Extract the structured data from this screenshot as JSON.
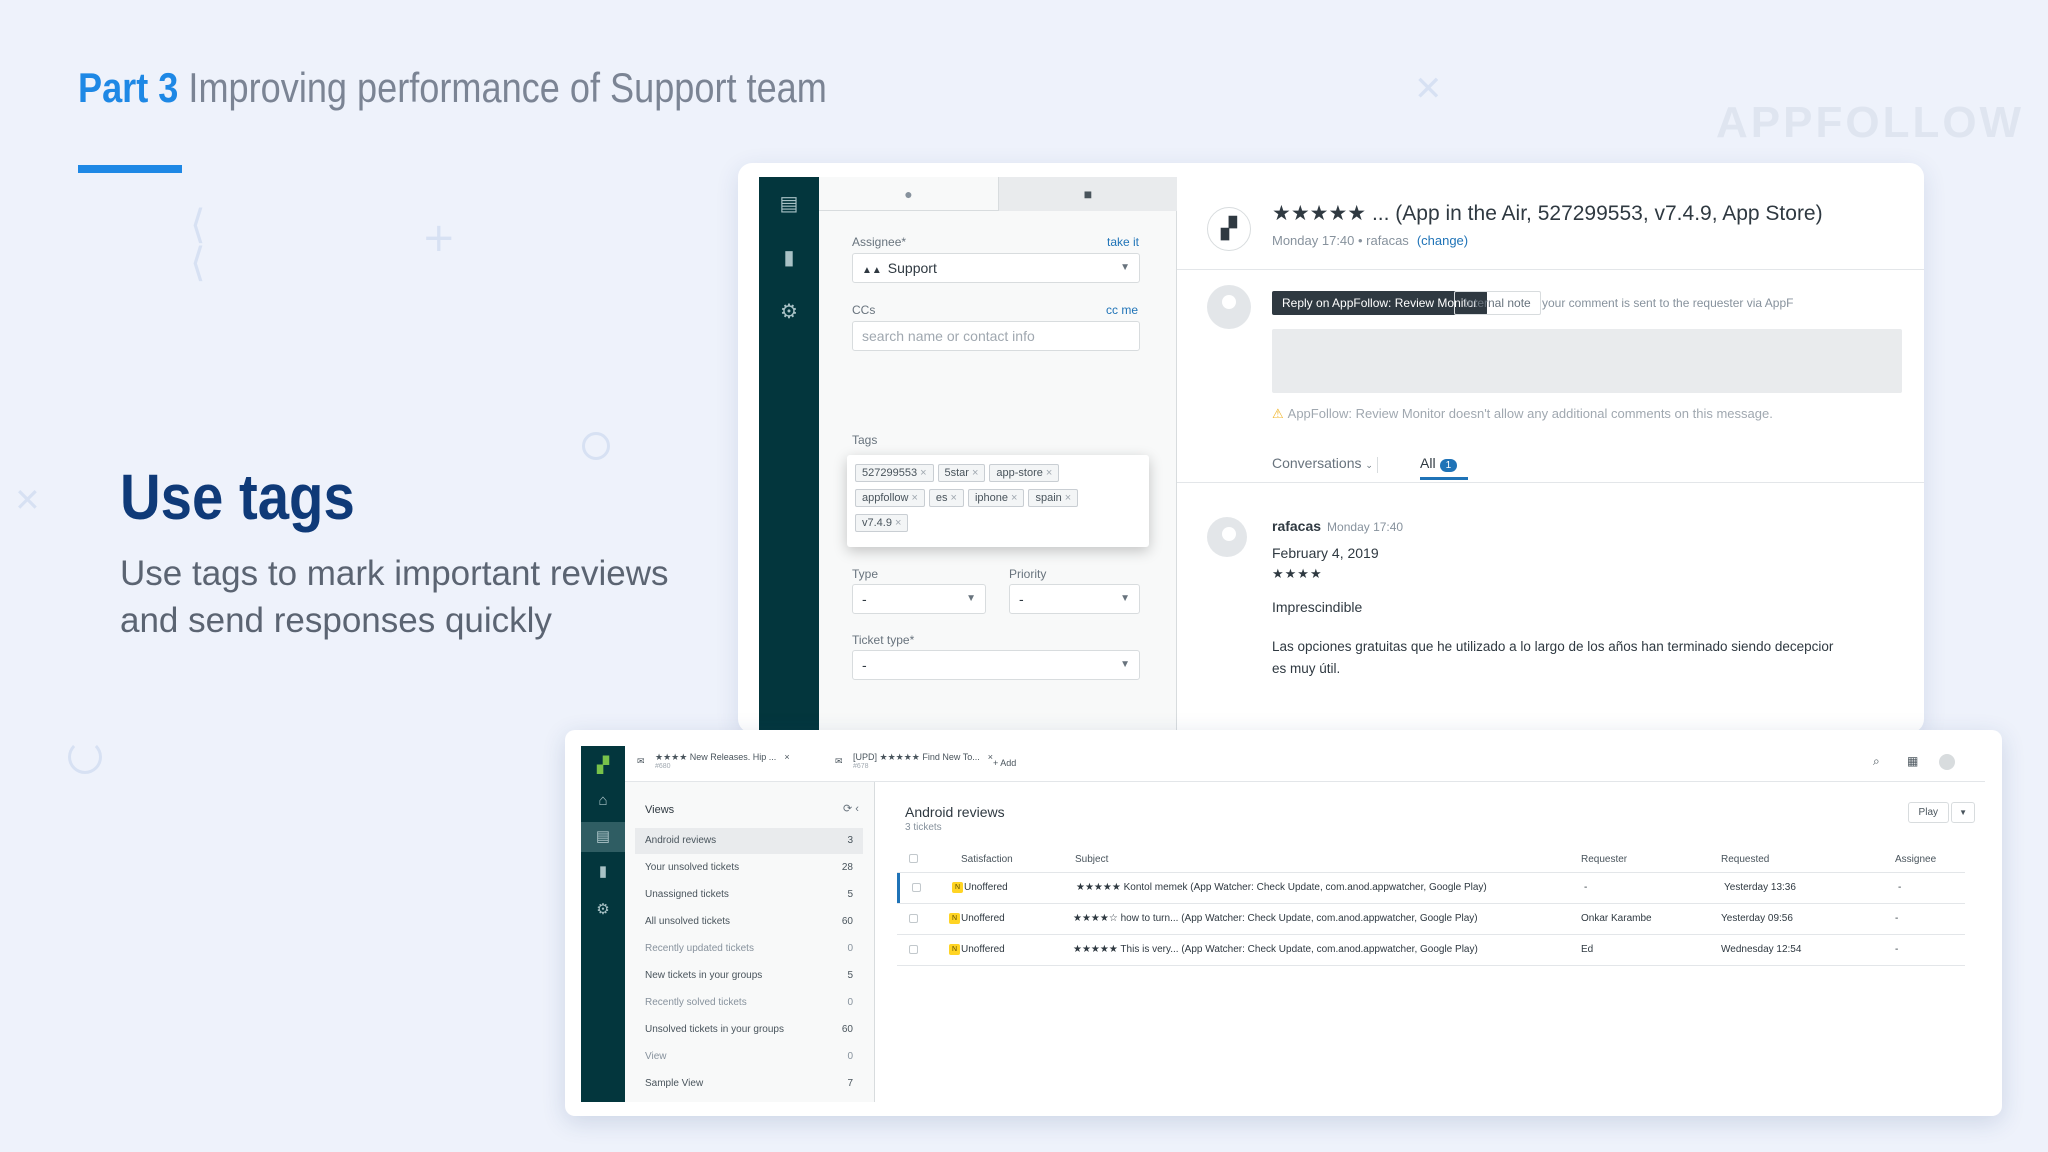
{
  "slide": {
    "part": "Part 3",
    "subtitle": "Improving performance of Support team",
    "brand": "APPFOLLOW",
    "heading": "Use tags",
    "desc_line1": "Use tags to mark important reviews",
    "desc_line2": "and send responses quickly"
  },
  "ticket_panel": {
    "assignee_label": "Assignee*",
    "take_it": "take it",
    "assignee_value": "Support",
    "ccs_label": "CCs",
    "cc_me": "cc me",
    "ccs_placeholder": "search name or contact info",
    "tags_label": "Tags",
    "tags": [
      "527299553",
      "5star",
      "app-store",
      "appfollow",
      "es",
      "iphone",
      "spain",
      "v7.4.9"
    ],
    "type_label": "Type",
    "type_value": "-",
    "priority_label": "Priority",
    "priority_value": "-",
    "ticket_type_label": "Ticket type*",
    "ticket_type_value": "-"
  },
  "ticket_main": {
    "title": "★★★★★ ... (App in the Air, 527299553, v7.4.9, App Store)",
    "meta": "Monday 17:40 • rafacas",
    "change": "(change)",
    "reply_button": "Reply on AppFollow: Review Monitor",
    "internal_note": "Internal note",
    "hint": "your comment is sent to the requester via AppF",
    "warning": "AppFollow: Review Monitor doesn't allow any additional comments on this message.",
    "conversations": "Conversations",
    "all_tab": "All",
    "all_count": "1",
    "comment": {
      "author": "rafacas",
      "time": "Monday 17:40",
      "date": "February 4, 2019",
      "stars": "★★★★",
      "headline": "Imprescindible",
      "body_line1": "Las opciones gratuitas que he utilizado a lo largo de los años han terminado siendo decepcior",
      "body_line2": "es muy útil."
    }
  },
  "list_window": {
    "tabs": [
      {
        "title": "★★★★ New Releases. Hip ...",
        "sub": "#680"
      },
      {
        "title": "[UPD] ★★★★★ Find New To...",
        "sub": "#678"
      }
    ],
    "add_label": "+ Add",
    "views_label": "Views",
    "views": [
      {
        "name": "Android reviews",
        "count": "3"
      },
      {
        "name": "Your unsolved tickets",
        "count": "28"
      },
      {
        "name": "Unassigned tickets",
        "count": "5"
      },
      {
        "name": "All unsolved tickets",
        "count": "60"
      },
      {
        "name": "Recently updated tickets",
        "count": "0"
      },
      {
        "name": "New tickets in your groups",
        "count": "5"
      },
      {
        "name": "Recently solved tickets",
        "count": "0"
      },
      {
        "name": "Unsolved tickets in your groups",
        "count": "60"
      },
      {
        "name": "View",
        "count": "0"
      },
      {
        "name": "Sample View",
        "count": "7"
      }
    ],
    "list_title": "Android reviews",
    "list_sub": "3 tickets",
    "play": "Play",
    "columns": [
      "Satisfaction",
      "Subject",
      "Requester",
      "Requested",
      "Assignee"
    ],
    "rows": [
      {
        "status": "N",
        "satisfaction": "Unoffered",
        "subject": "★★★★★ Kontol memek (App Watcher: Check Update, com.anod.appwatcher, Google Play)",
        "requester": "-",
        "requested": "Yesterday 13:36",
        "assignee": "-"
      },
      {
        "status": "N",
        "satisfaction": "Unoffered",
        "subject": "★★★★☆ how to turn... (App Watcher: Check Update, com.anod.appwatcher, Google Play)",
        "requester": "Onkar Karambe",
        "requested": "Yesterday 09:56",
        "assignee": "-"
      },
      {
        "status": "N",
        "satisfaction": "Unoffered",
        "subject": "★★★★★ This is very... (App Watcher: Check Update, com.anod.appwatcher, Google Play)",
        "requester": "Ed",
        "requested": "Wednesday 12:54",
        "assignee": "-"
      }
    ]
  }
}
